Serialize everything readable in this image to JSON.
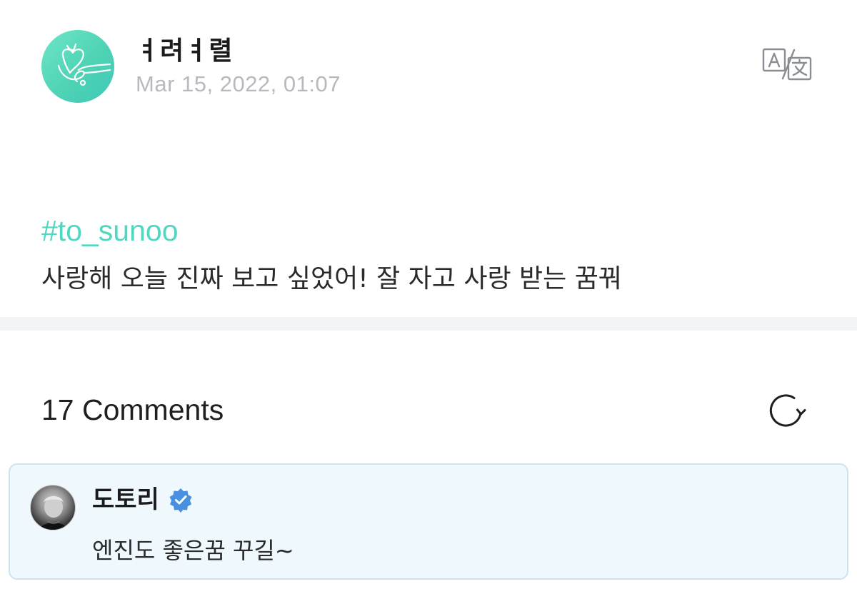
{
  "post": {
    "author_name": "ㅕ려ㅕ렬",
    "date": "Mar 15, 2022, 01:07",
    "hashtag": "#to_sunoo",
    "text": "사랑해 오늘 진짜 보고 싶었어! 잘 자고 사랑 받는 꿈꿔",
    "avatar_icon": "heart-doodle-icon",
    "translate_icon": "translate-icon"
  },
  "comments": {
    "title": "17 Comments",
    "refresh_icon": "refresh-icon",
    "items": [
      {
        "name": "도토리",
        "verified": true,
        "text": "엔진도 좋은꿈 꾸길~"
      }
    ]
  },
  "colors": {
    "accent": "#4fd7c0",
    "date_gray": "#b7b9be",
    "divider": "#f3f4f7",
    "comment_bg": "#eff8fd",
    "verified_blue": "#4a90e2"
  }
}
